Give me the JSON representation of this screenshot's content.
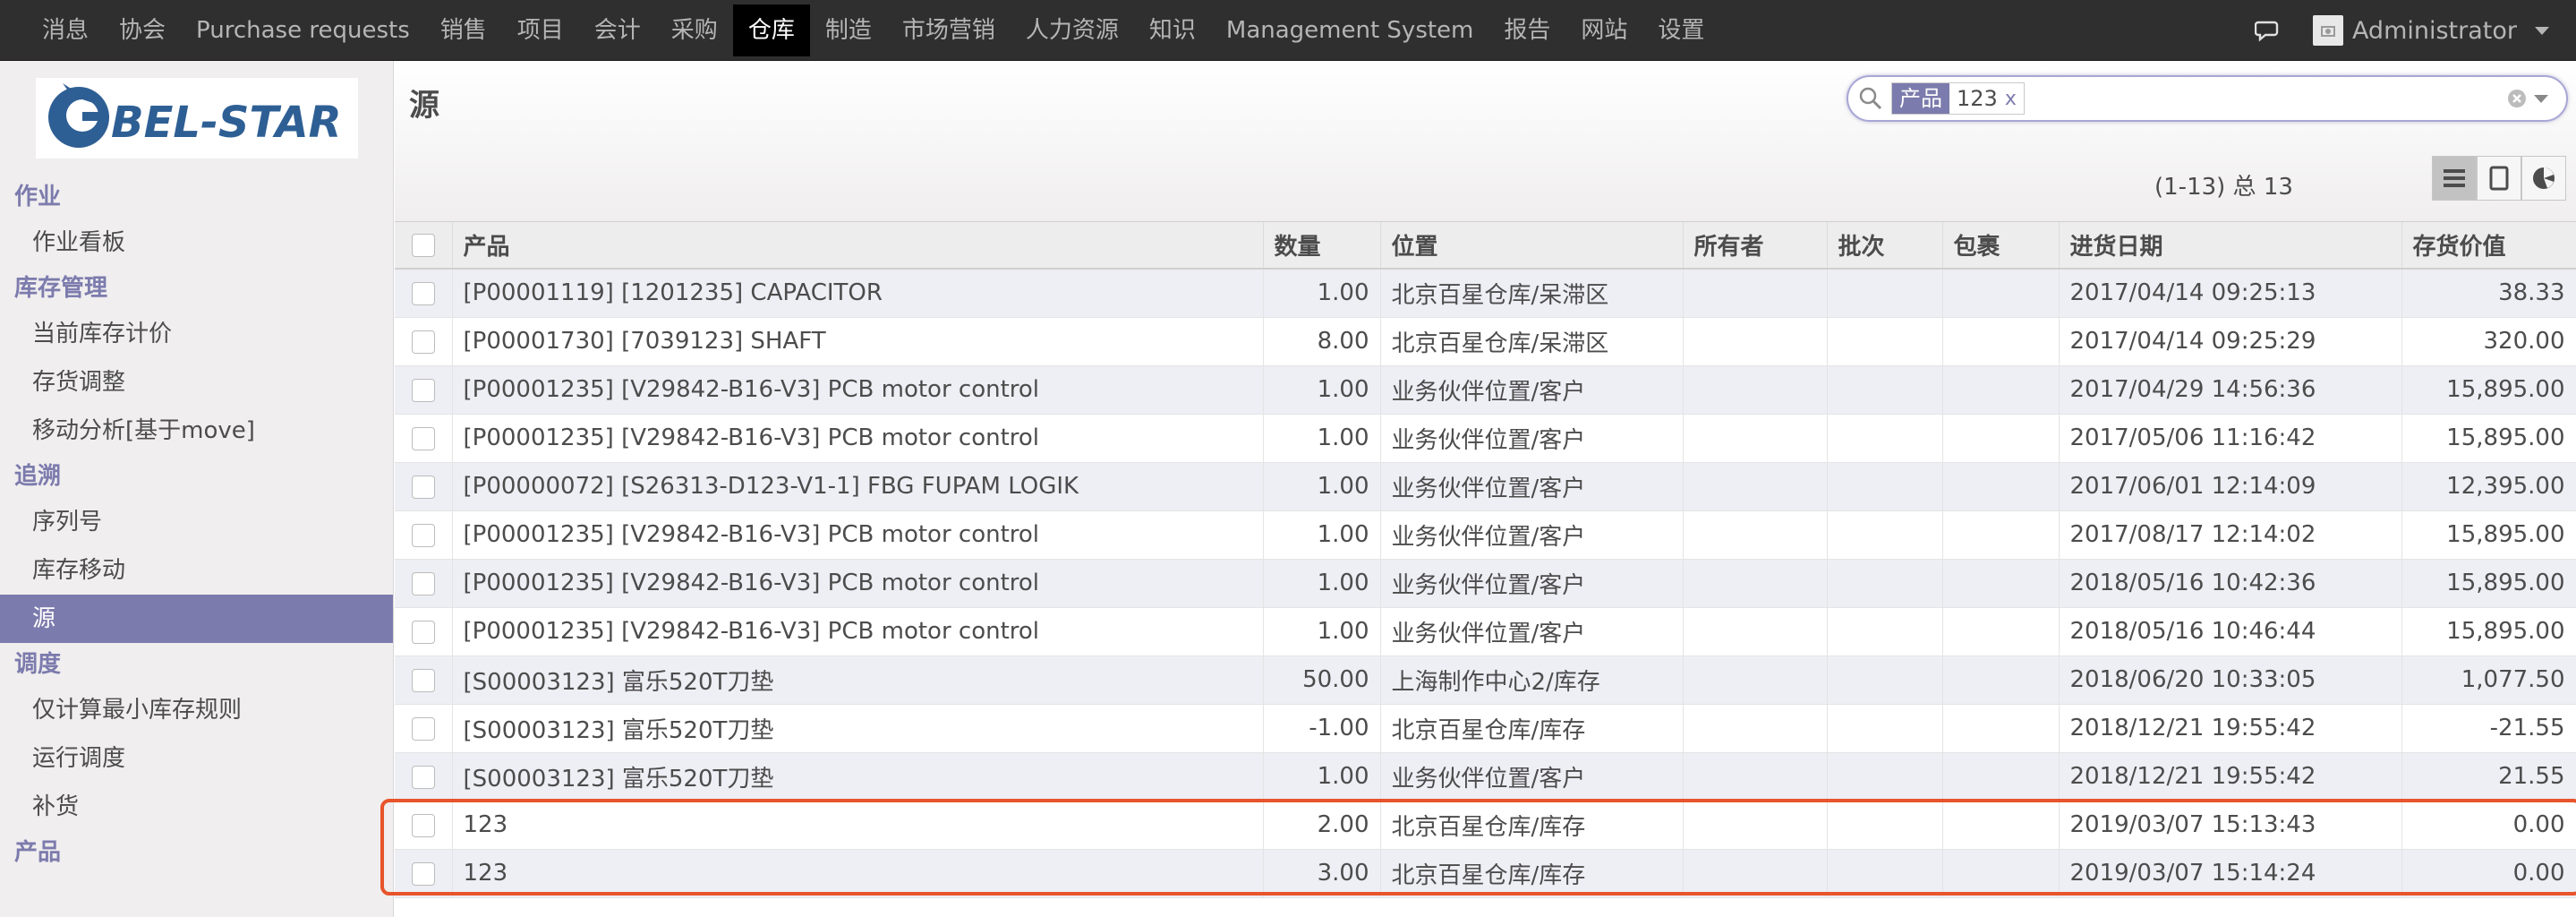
{
  "navbar": {
    "items": [
      "消息",
      "协会",
      "Purchase requests",
      "销售",
      "项目",
      "会计",
      "采购",
      "仓库",
      "制造",
      "市场营销",
      "人力资源",
      "知识",
      "Management System",
      "报告",
      "网站",
      "设置"
    ],
    "active_index": 7,
    "user": "Administrator"
  },
  "logo": {
    "text": "BEL-STAR",
    "color": "#2e5f94"
  },
  "sidebar": {
    "sections": [
      {
        "title": "作业",
        "items": [
          "作业看板"
        ]
      },
      {
        "title": "库存管理",
        "items": [
          "当前库存计价",
          "存货调整",
          "移动分析[基于move]"
        ]
      },
      {
        "title": "追溯",
        "items": [
          "序列号",
          "库存移动",
          "源"
        ]
      },
      {
        "title": "调度",
        "items": [
          "仅计算最小库存规则",
          "运行调度",
          "补货"
        ]
      },
      {
        "title": "产品",
        "items": []
      }
    ],
    "active_item": "源"
  },
  "page": {
    "title": "源"
  },
  "search": {
    "facet_label": "产品",
    "facet_value": "123",
    "facet_remove": "x",
    "query": ""
  },
  "pager": {
    "text": "(1-13) 总 13"
  },
  "table": {
    "columns": [
      "产品",
      "数量",
      "位置",
      "所有者",
      "批次",
      "包裹",
      "进货日期",
      "存货价值"
    ],
    "rows": [
      [
        "[P00001119] [1201235] CAPACITOR",
        "1.00",
        "北京百星仓库/呆滞区",
        "",
        "",
        "",
        "2017/04/14 09:25:13",
        "38.33"
      ],
      [
        "[P00001730] [7039123] SHAFT",
        "8.00",
        "北京百星仓库/呆滞区",
        "",
        "",
        "",
        "2017/04/14 09:25:29",
        "320.00"
      ],
      [
        "[P00001235] [V29842-B16-V3] PCB motor control",
        "1.00",
        "业务伙伴位置/客户",
        "",
        "",
        "",
        "2017/04/29 14:56:36",
        "15,895.00"
      ],
      [
        "[P00001235] [V29842-B16-V3] PCB motor control",
        "1.00",
        "业务伙伴位置/客户",
        "",
        "",
        "",
        "2017/05/06 11:16:42",
        "15,895.00"
      ],
      [
        "[P00000072] [S26313-D123-V1-1] FBG FUPAM LOGIK",
        "1.00",
        "业务伙伴位置/客户",
        "",
        "",
        "",
        "2017/06/01 12:14:09",
        "12,395.00"
      ],
      [
        "[P00001235] [V29842-B16-V3] PCB motor control",
        "1.00",
        "业务伙伴位置/客户",
        "",
        "",
        "",
        "2017/08/17 12:14:02",
        "15,895.00"
      ],
      [
        "[P00001235] [V29842-B16-V3] PCB motor control",
        "1.00",
        "业务伙伴位置/客户",
        "",
        "",
        "",
        "2018/05/16 10:42:36",
        "15,895.00"
      ],
      [
        "[P00001235] [V29842-B16-V3] PCB motor control",
        "1.00",
        "业务伙伴位置/客户",
        "",
        "",
        "",
        "2018/05/16 10:46:44",
        "15,895.00"
      ],
      [
        "[S00003123] 富乐520T刀垫",
        "50.00",
        "上海制作中心2/库存",
        "",
        "",
        "",
        "2018/06/20 10:33:05",
        "1,077.50"
      ],
      [
        "[S00003123] 富乐520T刀垫",
        "-1.00",
        "北京百星仓库/库存",
        "",
        "",
        "",
        "2018/12/21 19:55:42",
        "-21.55"
      ],
      [
        "[S00003123] 富乐520T刀垫",
        "1.00",
        "业务伙伴位置/客户",
        "",
        "",
        "",
        "2018/12/21 19:55:42",
        "21.55"
      ],
      [
        "123",
        "2.00",
        "北京百星仓库/库存",
        "",
        "",
        "",
        "2019/03/07 15:13:43",
        "0.00"
      ],
      [
        "123",
        "3.00",
        "北京百星仓库/库存",
        "",
        "",
        "",
        "2019/03/07 15:14:24",
        "0.00"
      ]
    ]
  },
  "colors": {
    "accent": "#7c7bad",
    "navbar": "#2f2f2f",
    "highlight": "#e8542b"
  }
}
